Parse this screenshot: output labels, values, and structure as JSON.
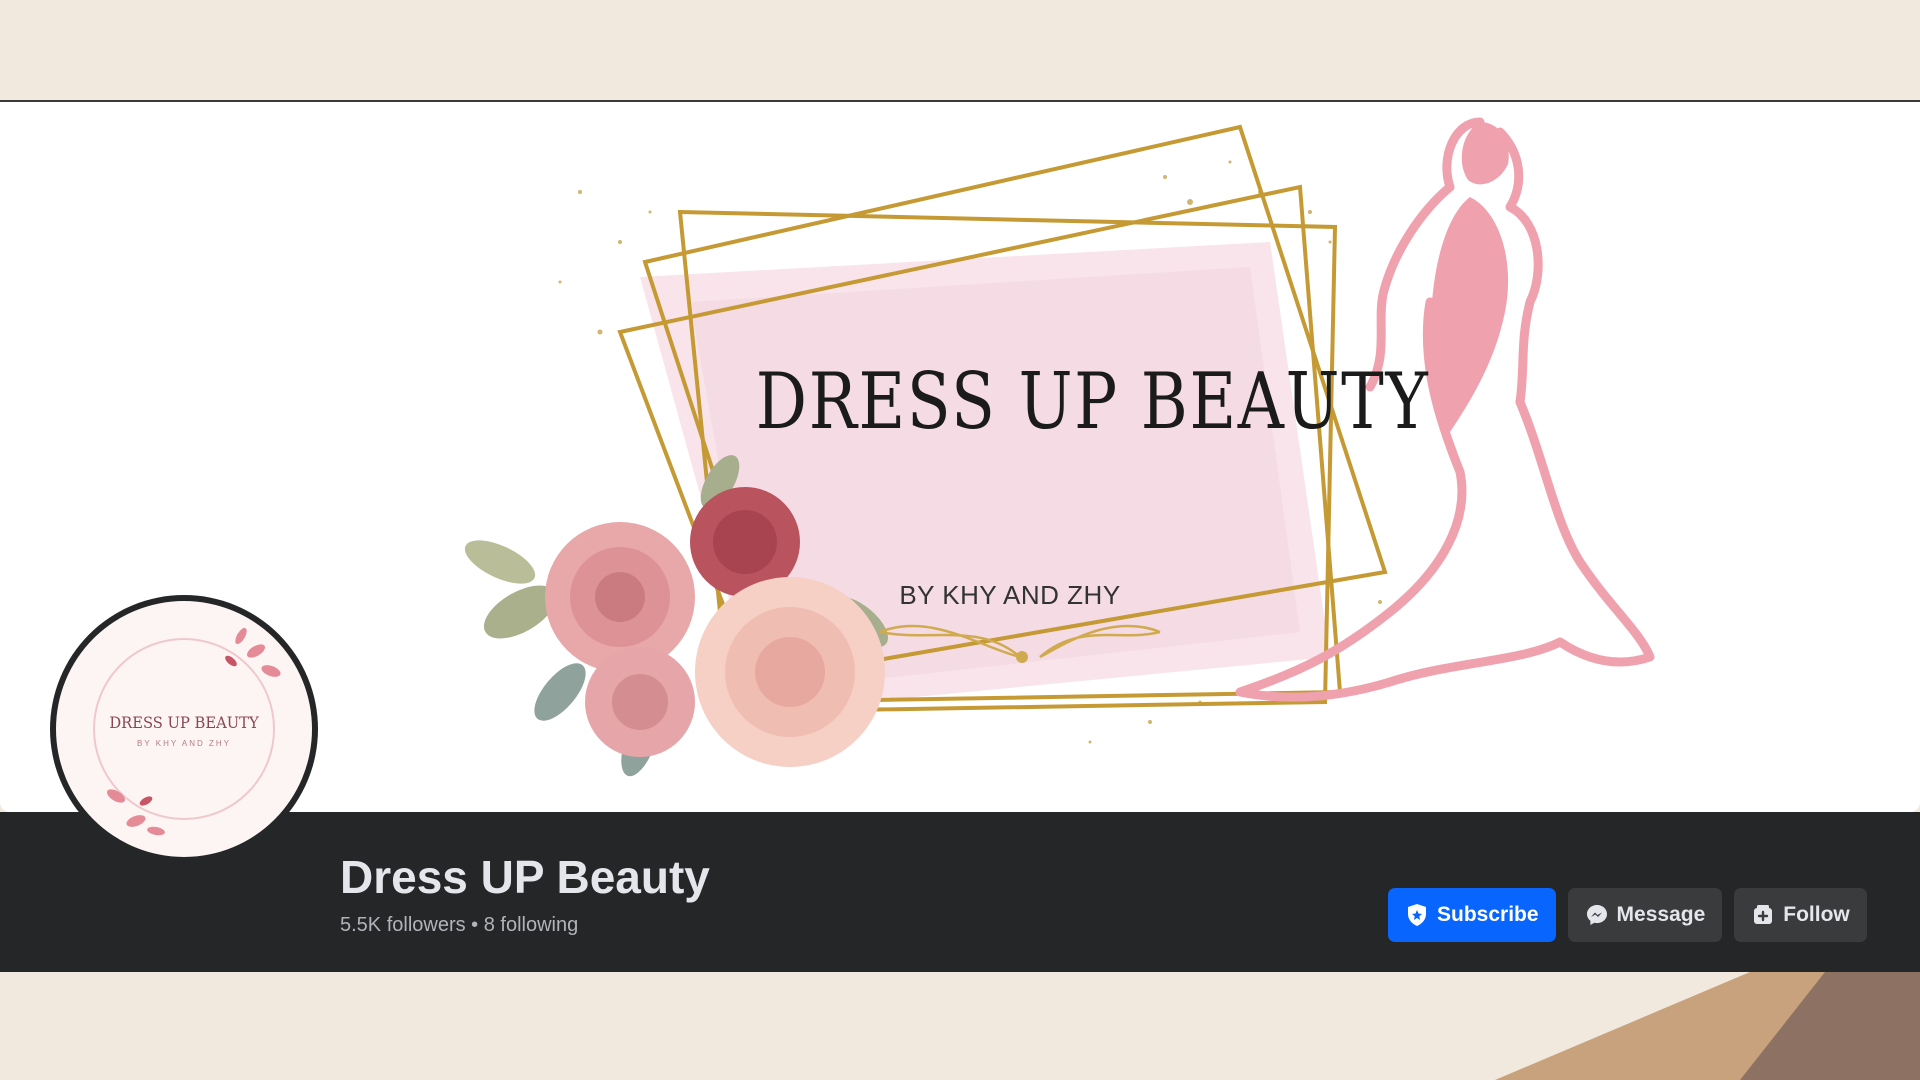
{
  "cover": {
    "title": "DRESS UP BEAUTY",
    "subtitle": "BY KHY AND ZHY"
  },
  "avatar": {
    "title": "DRESS UP BEAUTY",
    "subtitle": "BY KHY AND ZHY"
  },
  "page": {
    "name": "Dress UP Beauty",
    "stats": "5.5K followers • 8 following"
  },
  "actions": {
    "subscribe": "Subscribe",
    "message": "Message",
    "follow": "Follow"
  },
  "colors": {
    "background": "#f1e8de",
    "bar": "#252628",
    "primary": "#0866ff",
    "rose": "#f0a1ae",
    "gold": "#c59a34"
  }
}
